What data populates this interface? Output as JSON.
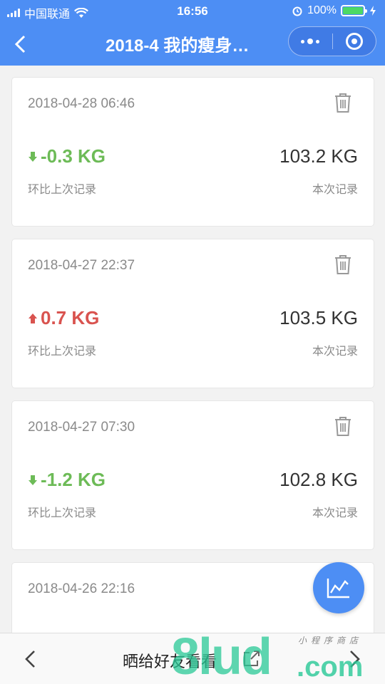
{
  "status_bar": {
    "carrier": "中国联通",
    "time": "16:56",
    "battery_percent": "100%",
    "battery_level": 1.0
  },
  "nav": {
    "title": "2018-4 我的瘦身…"
  },
  "records": [
    {
      "date": "2018-04-28 06:46",
      "delta": "-0.3 KG",
      "direction": "down",
      "current": "103.2 KG",
      "delta_label": "环比上次记录",
      "current_label": "本次记录"
    },
    {
      "date": "2018-04-27 22:37",
      "delta": "0.7 KG",
      "direction": "up",
      "current": "103.5 KG",
      "delta_label": "环比上次记录",
      "current_label": "本次记录"
    },
    {
      "date": "2018-04-27 07:30",
      "delta": "-1.2 KG",
      "direction": "down",
      "current": "102.8 KG",
      "delta_label": "环比上次记录",
      "current_label": "本次记录"
    },
    {
      "date": "2018-04-26 22:16"
    }
  ],
  "colors": {
    "brand": "#4d8ef4",
    "decrease": "#6dbb57",
    "increase": "#d9534f"
  },
  "bottom_bar": {
    "share_label": "晒给好友看看"
  },
  "watermark": {
    "main": "8lud",
    "suffix": ".com",
    "small": "小程序商店"
  }
}
